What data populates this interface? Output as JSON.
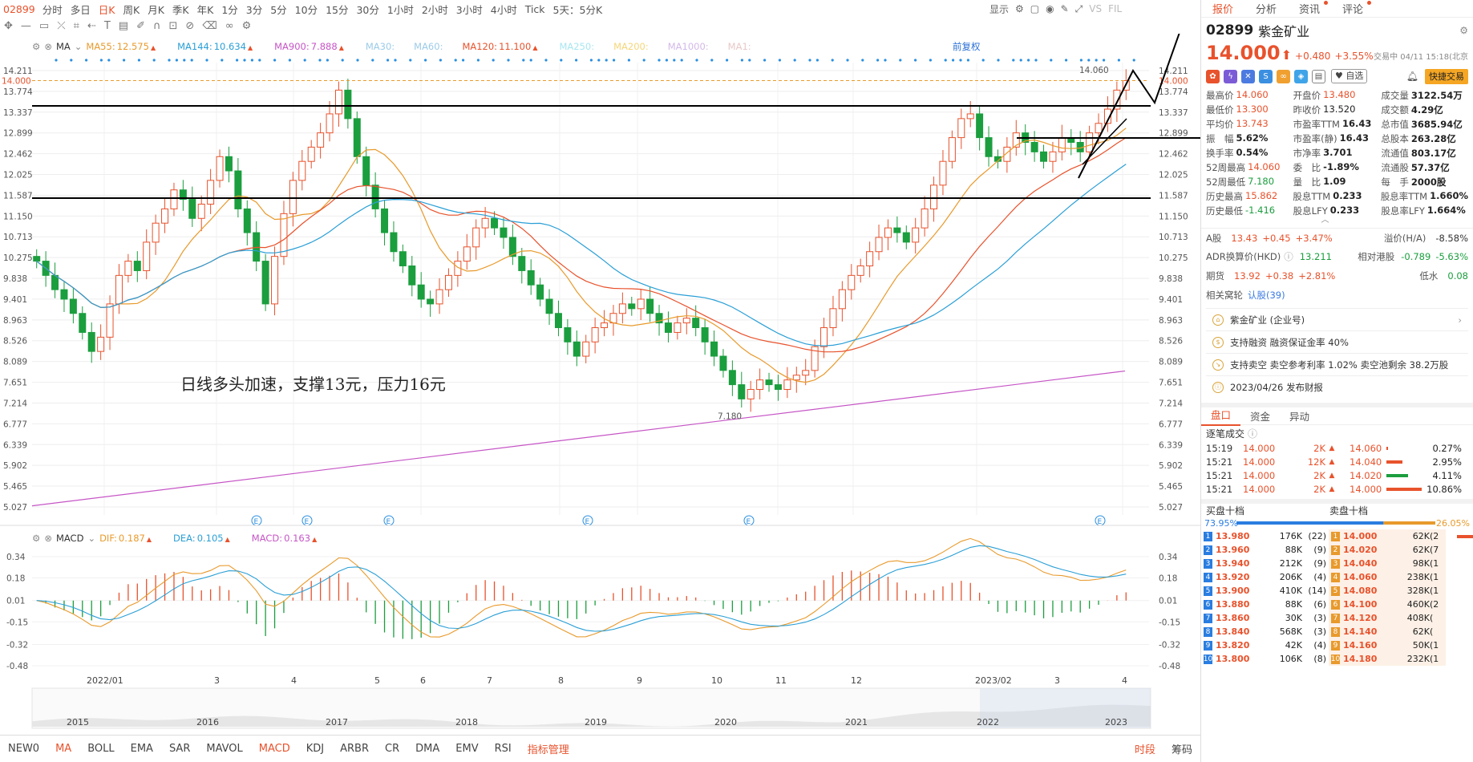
{
  "toolbar": {
    "symbol": "02899",
    "periods": [
      "分时",
      "多日",
      "日K",
      "周K",
      "月K",
      "季K",
      "年K",
      "1分",
      "3分",
      "5分",
      "10分",
      "15分",
      "30分",
      "1小时",
      "2小时",
      "3小时",
      "4小时",
      "Tick",
      "5天：5分K"
    ],
    "active_period": "日K",
    "right_items": [
      "显示",
      "VS",
      "FIL"
    ]
  },
  "ma_row": {
    "name": "MA",
    "items": [
      {
        "label": "MA55:",
        "value": "12.575",
        "color": "#e89a2c"
      },
      {
        "label": "MA144:",
        "value": "10.634",
        "color": "#2a9fd6"
      },
      {
        "label": "MA900:",
        "value": "7.888",
        "color": "#c655c6"
      },
      {
        "label": "MA30:",
        "value": "",
        "color": "#9ccbe8"
      },
      {
        "label": "MA60:",
        "value": "",
        "color": "#9ccbe8"
      },
      {
        "label": "MA120:",
        "value": "11.100",
        "color": "#e8522c"
      },
      {
        "label": "MA250:",
        "value": "",
        "color": "#a8e6f0"
      },
      {
        "label": "MA200:",
        "value": "",
        "color": "#f5d67a"
      },
      {
        "label": "MA1000:",
        "value": "",
        "color": "#d3b8e8"
      },
      {
        "label": "MA1:",
        "value": "",
        "color": "#e8c8c8"
      }
    ],
    "adjust": "前复权"
  },
  "macd_row": {
    "name": "MACD",
    "items": [
      {
        "label": "DIF:",
        "value": "0.187",
        "color": "#e89a2c"
      },
      {
        "label": "DEA:",
        "value": "0.105",
        "color": "#2a9fd6"
      },
      {
        "label": "MACD:",
        "value": "0.163",
        "color": "#c655c6"
      }
    ]
  },
  "price_axis": [
    "14.211",
    "13.774",
    "13.337",
    "12.899",
    "12.462",
    "12.025",
    "11.587",
    "11.150",
    "10.713",
    "10.275",
    "9.838",
    "9.401",
    "8.963",
    "8.526",
    "8.089",
    "7.651",
    "7.214",
    "6.777",
    "6.339",
    "5.902",
    "5.465",
    "5.027"
  ],
  "current_price_tag": "14.000",
  "max_label": "14.060",
  "min_label": "7.180",
  "annotation": "日线多头加速，支撑13元，压力16元",
  "macd_axis": [
    "0.34",
    "0.18",
    "0.01",
    "-0.15",
    "-0.32",
    "-0.48"
  ],
  "date_axis": [
    "2022/01",
    "3",
    "4",
    "5",
    "6",
    "7",
    "8",
    "9",
    "10",
    "11",
    "12",
    "2023/02",
    "3",
    "4"
  ],
  "overview_years": [
    "2015",
    "2016",
    "2017",
    "2018",
    "2019",
    "2020",
    "2021",
    "2022",
    "2023"
  ],
  "bottom_indicators": [
    "NEW0",
    "MA",
    "BOLL",
    "EMA",
    "SAR",
    "MAVOL",
    "MACD",
    "KDJ",
    "ARBR",
    "CR",
    "DMA",
    "EMV",
    "RSI",
    "指标管理"
  ],
  "bottom_right": [
    "时段",
    "筹码"
  ],
  "right": {
    "tabs": [
      "报价",
      "分析",
      "资讯",
      "评论"
    ],
    "code": "02899",
    "name": "紫金矿业",
    "price": "14.000",
    "change": "+0.480",
    "change_pct": "+3.55%",
    "trade_time": "交易中 04/11 15:18(北京",
    "fav_label": "自选",
    "quick_trade": "快捷交易",
    "stats": [
      [
        [
          "最高价",
          "14.060",
          "r"
        ],
        [
          "开盘价",
          "13.480",
          "r"
        ],
        [
          "成交量",
          "3122.54万",
          "b"
        ]
      ],
      [
        [
          "最低价",
          "13.300",
          "r"
        ],
        [
          "昨收价",
          "13.520",
          ""
        ],
        [
          "成交额",
          "4.29亿",
          "b"
        ]
      ],
      [
        [
          "平均价",
          "13.743",
          "r"
        ],
        [
          "市盈率TTM",
          "16.43",
          "b"
        ],
        [
          "总市值",
          "3685.94亿",
          "b"
        ]
      ],
      [
        [
          "振　幅",
          "5.62%",
          "b"
        ],
        [
          "市盈率(静)",
          "16.43",
          "b"
        ],
        [
          "总股本",
          "263.28亿",
          "b"
        ]
      ],
      [
        [
          "换手率",
          "0.54%",
          "b"
        ],
        [
          "市净率",
          "3.701",
          "b"
        ],
        [
          "流通值",
          "803.17亿",
          "b"
        ]
      ],
      [
        [
          "52周最高",
          "14.060",
          "r"
        ],
        [
          "委　比",
          "-1.89%",
          "b"
        ],
        [
          "流通股",
          "57.37亿",
          "b"
        ]
      ],
      [
        [
          "52周最低",
          "7.180",
          "g"
        ],
        [
          "量　比",
          "1.09",
          "b"
        ],
        [
          "每　手",
          "2000股",
          "b"
        ]
      ],
      [
        [
          "历史最高",
          "15.862",
          "r"
        ],
        [
          "股息TTM",
          "0.233",
          "b"
        ],
        [
          "股息率TTM",
          "1.660%",
          "b"
        ]
      ],
      [
        [
          "历史最低",
          "-1.416",
          "g"
        ],
        [
          "股息LFY",
          "0.233",
          "b"
        ],
        [
          "股息率LFY",
          "1.664%",
          "b"
        ]
      ]
    ],
    "a_share": {
      "label": "A股",
      "price": "13.43",
      "chg": "+0.45",
      "pct": "+3.47%",
      "premium_label": "溢价(H/A)",
      "premium": "-8.58%"
    },
    "adr": {
      "label": "ADR换算价(HKD)",
      "price": "13.211",
      "rel_label": "相对港股",
      "rel": "-0.789",
      "rel_pct": "-5.63%"
    },
    "futures": {
      "label": "期货",
      "price": "13.92",
      "chg": "+0.38",
      "pct": "+2.81%",
      "low_label": "低水",
      "low": "0.08"
    },
    "warrants": {
      "label": "相关窝轮",
      "link": "认股(39)"
    },
    "info": [
      "紫金矿业 (企业号)",
      "支持融资 融资保证金率 40%",
      "支持卖空 卖空参考利率 1.02% 卖空池剩余 38.2万股",
      "2023/04/26 发布财报"
    ],
    "subtabs": [
      "盘口",
      "资金",
      "异动"
    ],
    "ticks_title": "逐笔成交",
    "ticks": [
      {
        "t": "15:19",
        "p": "14.000",
        "v": "2K",
        "dp": "14.060",
        "pct": "0.27%",
        "w": 0.05,
        "c": "#e8522c"
      },
      {
        "t": "15:21",
        "p": "14.000",
        "v": "12K",
        "dp": "14.040",
        "pct": "2.95%",
        "w": 0.45,
        "c": "#e8522c"
      },
      {
        "t": "15:21",
        "p": "14.000",
        "v": "2K",
        "dp": "14.020",
        "pct": "4.11%",
        "w": 0.62,
        "c": "#1b9e3e"
      },
      {
        "t": "15:21",
        "p": "14.000",
        "v": "2K",
        "dp": "14.000",
        "pct": "10.86%",
        "w": 1.0,
        "c": "#e8522c"
      }
    ],
    "ob_titles": [
      "买盘十档",
      "卖盘十档"
    ],
    "ob_ratio": {
      "buy": "73.95%",
      "sell": "26.05%",
      "buy_frac": 0.7395
    },
    "bids": [
      {
        "n": "1",
        "p": "13.980",
        "v": "176K",
        "c": "22"
      },
      {
        "n": "2",
        "p": "13.960",
        "v": "88K",
        "c": "9"
      },
      {
        "n": "3",
        "p": "13.940",
        "v": "212K",
        "c": "9"
      },
      {
        "n": "4",
        "p": "13.920",
        "v": "206K",
        "c": "4"
      },
      {
        "n": "5",
        "p": "13.900",
        "v": "410K",
        "c": "14"
      },
      {
        "n": "6",
        "p": "13.880",
        "v": "88K",
        "c": "6"
      },
      {
        "n": "7",
        "p": "13.860",
        "v": "30K",
        "c": "3"
      },
      {
        "n": "8",
        "p": "13.840",
        "v": "568K",
        "c": "3"
      },
      {
        "n": "9",
        "p": "13.820",
        "v": "42K",
        "c": "4"
      },
      {
        "n": "10",
        "p": "13.800",
        "v": "106K",
        "c": "8"
      }
    ],
    "asks": [
      {
        "n": "1",
        "p": "14.000",
        "v": "62K",
        "c": "2"
      },
      {
        "n": "2",
        "p": "14.020",
        "v": "62K",
        "c": "7"
      },
      {
        "n": "3",
        "p": "14.040",
        "v": "98K",
        "c": "1"
      },
      {
        "n": "4",
        "p": "14.060",
        "v": "238K",
        "c": "1"
      },
      {
        "n": "5",
        "p": "14.080",
        "v": "328K",
        "c": "1"
      },
      {
        "n": "6",
        "p": "14.100",
        "v": "460K",
        "c": "2"
      },
      {
        "n": "7",
        "p": "14.120",
        "v": "408K",
        "c": ""
      },
      {
        "n": "8",
        "p": "14.140",
        "v": "62K",
        "c": ""
      },
      {
        "n": "9",
        "p": "14.160",
        "v": "50K",
        "c": "1"
      },
      {
        "n": "10",
        "p": "14.180",
        "v": "232K",
        "c": "1"
      }
    ]
  },
  "chart_data": {
    "type": "candlestick",
    "symbol": "02899",
    "period": "日K",
    "ylim": [
      5.027,
      14.211
    ],
    "close_series": [
      10.2,
      9.9,
      9.6,
      9.4,
      9.1,
      8.7,
      8.3,
      8.6,
      9.3,
      9.9,
      10.2,
      10.0,
      10.6,
      11.0,
      11.3,
      11.7,
      11.5,
      11.1,
      11.4,
      11.9,
      12.4,
      12.1,
      11.3,
      10.8,
      10.2,
      9.3,
      10.3,
      11.2,
      11.9,
      12.3,
      12.6,
      12.9,
      13.3,
      13.8,
      13.2,
      12.4,
      11.8,
      11.3,
      10.8,
      10.4,
      10.1,
      9.7,
      9.4,
      9.3,
      9.6,
      9.9,
      10.2,
      10.5,
      10.9,
      11.1,
      10.9,
      10.7,
      10.3,
      10.0,
      9.7,
      9.4,
      9.1,
      8.8,
      8.5,
      8.2,
      8.5,
      8.8,
      8.9,
      9.1,
      9.3,
      9.2,
      9.4,
      9.1,
      8.9,
      8.7,
      8.9,
      9.0,
      8.8,
      8.5,
      8.2,
      7.9,
      7.6,
      7.3,
      7.5,
      7.7,
      7.6,
      7.5,
      7.7,
      7.8,
      7.9,
      8.4,
      8.8,
      9.2,
      9.6,
      9.9,
      10.1,
      10.4,
      10.7,
      10.9,
      10.8,
      10.6,
      10.9,
      11.3,
      11.8,
      12.3,
      12.8,
      13.2,
      13.3,
      12.8,
      12.4,
      12.3,
      12.6,
      12.9,
      12.7,
      12.5,
      12.3,
      12.5,
      12.8,
      12.7,
      12.5,
      12.9,
      13.1,
      13.4,
      13.8,
      14.0
    ]
  }
}
